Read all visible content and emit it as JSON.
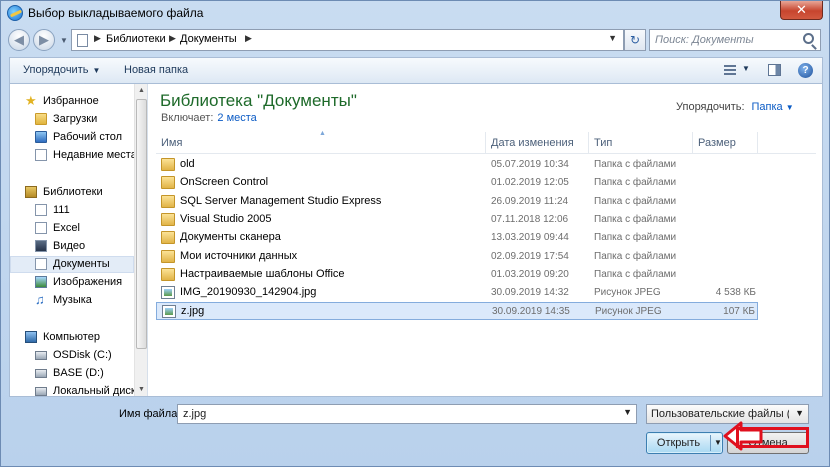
{
  "window": {
    "title": "Выбор выкладываемого файла",
    "close_label": "✕"
  },
  "address": {
    "crumbs": [
      "Библиотеки",
      "Документы"
    ],
    "search_placeholder": "Поиск: Документы"
  },
  "toolbar": {
    "organize_label": "Упорядочить",
    "new_folder_label": "Новая папка"
  },
  "nav": {
    "favorites": "Избранное",
    "downloads": "Загрузки",
    "desktop": "Рабочий стол",
    "recent": "Недавние места",
    "libraries": "Библиотеки",
    "lib_111": "111",
    "lib_excel": "Excel",
    "lib_video": "Видео",
    "lib_documents": "Документы",
    "lib_images": "Изображения",
    "lib_music": "Музыка",
    "computer": "Компьютер",
    "disk_c": "OSDisk (C:)",
    "disk_d": "BASE (D:)",
    "disk_local": "Локальный диск"
  },
  "library": {
    "title": "Библиотека \"Документы\"",
    "includes_label": "Включает:",
    "includes_link": "2 места",
    "arrange_label": "Упорядочить:",
    "arrange_value": "Папка"
  },
  "columns": {
    "name": "Имя",
    "date": "Дата изменения",
    "type": "Тип",
    "size": "Размер"
  },
  "files": [
    {
      "name": "old",
      "date": "05.07.2019 10:34",
      "type": "Папка с файлами",
      "size": "",
      "icon": "folder"
    },
    {
      "name": "OnScreen Control",
      "date": "01.02.2019 12:05",
      "type": "Папка с файлами",
      "size": "",
      "icon": "folder"
    },
    {
      "name": "SQL Server Management Studio Express",
      "date": "26.09.2019 11:24",
      "type": "Папка с файлами",
      "size": "",
      "icon": "folder"
    },
    {
      "name": "Visual Studio 2005",
      "date": "07.11.2018 12:06",
      "type": "Папка с файлами",
      "size": "",
      "icon": "folder"
    },
    {
      "name": "Документы сканера",
      "date": "13.03.2019 09:44",
      "type": "Папка с файлами",
      "size": "",
      "icon": "folder"
    },
    {
      "name": "Мои источники данных",
      "date": "02.09.2019 17:54",
      "type": "Папка с файлами",
      "size": "",
      "icon": "folder"
    },
    {
      "name": "Настраиваемые шаблоны Office",
      "date": "01.03.2019 09:20",
      "type": "Папка с файлами",
      "size": "",
      "icon": "folder"
    },
    {
      "name": "IMG_20190930_142904.jpg",
      "date": "30.09.2019 14:32",
      "type": "Рисунок JPEG",
      "size": "4 538 КБ",
      "icon": "jpg"
    },
    {
      "name": "z.jpg",
      "date": "30.09.2019 14:35",
      "type": "Рисунок JPEG",
      "size": "107 КБ",
      "icon": "jpg"
    }
  ],
  "bottom": {
    "filename_label": "Имя файла:",
    "filename_value": "z.jpg",
    "filter_value": "Пользовательские файлы (*.jp",
    "open_label": "Открыть",
    "cancel_label": "Отмена"
  },
  "colors": {
    "annotation": "#e0101e",
    "link": "#0b5bc5",
    "library_title": "#1e6a2a"
  }
}
